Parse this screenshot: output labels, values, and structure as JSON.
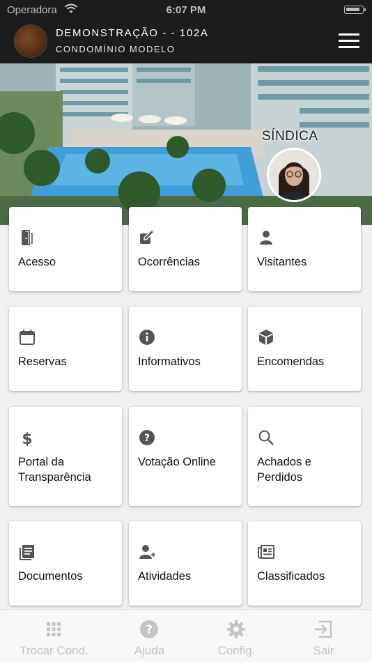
{
  "status_bar": {
    "carrier": "Operadora",
    "time": "6:07 PM"
  },
  "header": {
    "unit": "DEMONSTRAÇÃO - - 102A",
    "condo": "CONDOMÍNIO MODELO"
  },
  "hero": {
    "badge": "SÍNDICA"
  },
  "menu": [
    {
      "label": "Acesso",
      "icon": "door-icon"
    },
    {
      "label": "Ocorrências",
      "icon": "edit-icon"
    },
    {
      "label": "Visitantes",
      "icon": "person-icon"
    },
    {
      "label": "Reservas",
      "icon": "calendar-icon"
    },
    {
      "label": "Informativos",
      "icon": "info-icon"
    },
    {
      "label": "Encomendas",
      "icon": "package-icon"
    },
    {
      "label": "Portal da Transparência",
      "icon": "dollar-icon"
    },
    {
      "label": "Votação Online",
      "icon": "help-icon"
    },
    {
      "label": "Achados e Perdidos",
      "icon": "search-icon"
    },
    {
      "label": "Documentos",
      "icon": "document-icon"
    },
    {
      "label": "Atividades",
      "icon": "person-add-icon"
    },
    {
      "label": "Classificados",
      "icon": "newspaper-icon"
    }
  ],
  "tabbar": [
    {
      "label": "Trocar Cond.",
      "icon": "grid-icon"
    },
    {
      "label": "Ajuda",
      "icon": "help-circle-icon"
    },
    {
      "label": "Config.",
      "icon": "gear-icon"
    },
    {
      "label": "Sair",
      "icon": "exit-icon"
    }
  ],
  "colors": {
    "header_bg": "#1c1c1c",
    "icon": "#555555",
    "tab_inactive": "#c4c4c4"
  }
}
